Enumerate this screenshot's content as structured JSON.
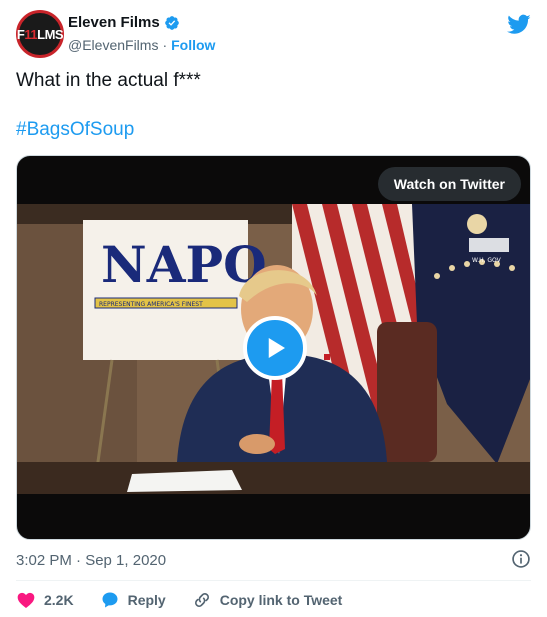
{
  "author": {
    "display_name": "Eleven Films",
    "handle": "@ElevenFilms",
    "separator": "·",
    "follow_label": "Follow",
    "avatar_text_1": "F",
    "avatar_text_hl": "11",
    "avatar_text_2": "LMS"
  },
  "tweet": {
    "text": "What in the actual f***",
    "hashtag": "#BagsOfSoup"
  },
  "media": {
    "watch_label": "Watch on Twitter",
    "sign_title": "NAPO",
    "sign_tagline": "REPRESENTING AMERICA'S FINEST",
    "wh_caption": "W.H. GOV"
  },
  "meta": {
    "timestamp": "3:02 PM · Sep 1, 2020"
  },
  "actions": {
    "like_count": "2.2K",
    "reply_label": "Reply",
    "copy_label": "Copy link to Tweet"
  },
  "colors": {
    "accent": "#1d9bf0",
    "like": "#f91880",
    "text_secondary": "#536471"
  },
  "icons": [
    "verified-badge-icon",
    "twitter-bird-icon",
    "play-icon",
    "info-icon",
    "heart-icon",
    "reply-bubble-icon",
    "link-icon"
  ]
}
